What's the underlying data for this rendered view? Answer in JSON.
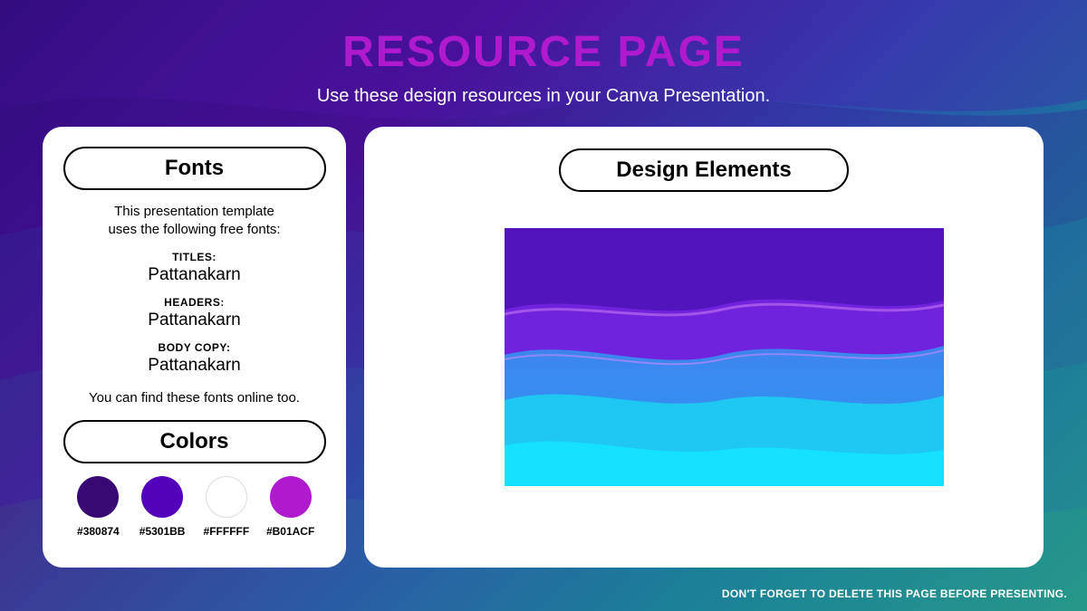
{
  "header": {
    "title": "RESOURCE PAGE",
    "subtitle": "Use these design resources in your Canva Presentation."
  },
  "fonts_card": {
    "heading": "Fonts",
    "intro_line1": "This presentation template",
    "intro_line2": "uses the following free fonts:",
    "titles_label": "TITLES:",
    "titles_font": "Pattanakarn",
    "headers_label": "HEADERS:",
    "headers_font": "Pattanakarn",
    "body_label": "BODY COPY:",
    "body_font": "Pattanakarn",
    "note": "You can find these fonts online too.",
    "colors_heading": "Colors"
  },
  "colors": [
    {
      "hex": "#380874"
    },
    {
      "hex": "#5301BB"
    },
    {
      "hex": "#FFFFFF"
    },
    {
      "hex": "#B01ACF"
    }
  ],
  "elements_card": {
    "heading": "Design Elements"
  },
  "footer": {
    "note": "DON'T FORGET TO DELETE THIS PAGE BEFORE PRESENTING."
  }
}
